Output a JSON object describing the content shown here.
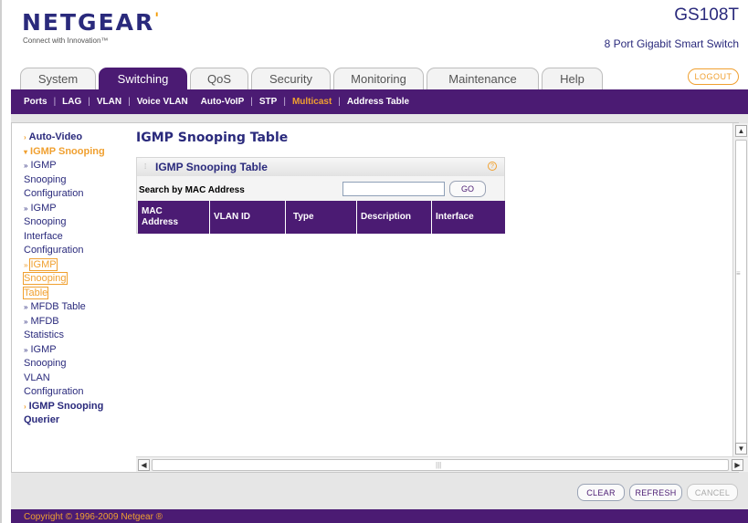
{
  "header": {
    "logo": "NETGEAR",
    "tagline": "Connect with Innovation™",
    "model": "GS108T",
    "model_desc": "8 Port Gigabit Smart Switch",
    "logout": "LOGOUT"
  },
  "tabs": [
    {
      "label": "System"
    },
    {
      "label": "Switching",
      "active": true
    },
    {
      "label": "QoS"
    },
    {
      "label": "Security"
    },
    {
      "label": "Monitoring"
    },
    {
      "label": "Maintenance"
    },
    {
      "label": "Help"
    }
  ],
  "subnav": [
    {
      "label": "Ports"
    },
    {
      "label": "LAG"
    },
    {
      "label": "VLAN"
    },
    {
      "label": "Voice VLAN"
    },
    {
      "label": "Auto-VoIP"
    },
    {
      "label": "STP"
    },
    {
      "label": "Multicast",
      "active": true
    },
    {
      "label": "Address Table"
    }
  ],
  "sidebar": {
    "auto_video": "Auto-Video",
    "igmp_snooping": "IGMP Snooping",
    "igmp_snooping_configuration": [
      "IGMP",
      "Snooping",
      "Configuration"
    ],
    "igmp_snooping_interface_configuration": [
      "IGMP",
      "Snooping",
      "Interface",
      "Configuration"
    ],
    "igmp_snooping_table": [
      "IGMP",
      "Snooping",
      "Table"
    ],
    "mfdb_table": "MFDB Table",
    "mfdb_statistics": [
      "MFDB",
      "Statistics"
    ],
    "igmp_snooping_vlan_configuration": [
      "IGMP",
      "Snooping",
      "VLAN",
      "Configuration"
    ],
    "igmp_snooping_querier": [
      "IGMP Snooping",
      "Querier"
    ]
  },
  "main": {
    "title": "IGMP Snooping Table",
    "panel_title": "IGMP Snooping Table",
    "search_label": "Search by MAC Address",
    "search_value": "",
    "go": "GO",
    "columns": [
      [
        "MAC",
        "Address"
      ],
      [
        "VLAN ID"
      ],
      [
        "Type"
      ],
      [
        "Description"
      ],
      [
        "Interface"
      ]
    ]
  },
  "buttons": {
    "clear": "CLEAR",
    "refresh": "REFRESH",
    "cancel": "CANCEL"
  },
  "footer": {
    "copyright": "Copyright © 1996-2009 Netgear ®"
  },
  "colors": {
    "brand_purple": "#4b1b73",
    "accent_orange": "#f0a030",
    "link_navy": "#2a2a7c"
  }
}
